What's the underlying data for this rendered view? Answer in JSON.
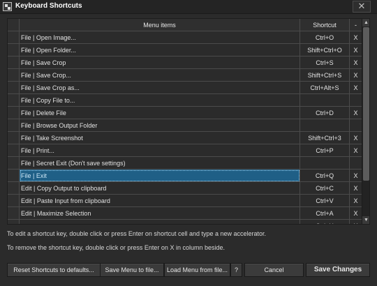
{
  "window": {
    "title": "Keyboard Shortcuts",
    "close_glyph": "✕"
  },
  "table": {
    "headers": {
      "item": "Menu items",
      "shortcut": "Shortcut",
      "remove": "-"
    },
    "selected_index": 13,
    "rows": [
      {
        "item": "File | Open Image...",
        "shortcut": "Ctrl+O",
        "remove": "X"
      },
      {
        "item": "File | Open Folder...",
        "shortcut": "Shift+Ctrl+O",
        "remove": "X"
      },
      {
        "item": "File | Save Crop",
        "shortcut": "Ctrl+S",
        "remove": "X"
      },
      {
        "item": "File | Save Crop...",
        "shortcut": "Shift+Ctrl+S",
        "remove": "X"
      },
      {
        "item": "File | Save Crop as...",
        "shortcut": "Ctrl+Alt+S",
        "remove": "X"
      },
      {
        "item": "File | Copy File to...",
        "shortcut": "",
        "remove": ""
      },
      {
        "item": "File | Delete File",
        "shortcut": "Ctrl+D",
        "remove": "X"
      },
      {
        "item": "File | Browse Output Folder",
        "shortcut": "",
        "remove": ""
      },
      {
        "item": "File | Take Screenshot",
        "shortcut": "Shift+Ctrl+3",
        "remove": "X"
      },
      {
        "item": "File | Print...",
        "shortcut": "Ctrl+P",
        "remove": "X"
      },
      {
        "item": "File | Secret Exit (Don't save settings)",
        "shortcut": "",
        "remove": ""
      },
      {
        "item": "File | Exit",
        "shortcut": "Ctrl+Q",
        "remove": "X"
      },
      {
        "item": "Edit | Copy Output to clipboard",
        "shortcut": "Ctrl+C",
        "remove": "X"
      },
      {
        "item": "Edit | Paste Input from clipboard",
        "shortcut": "Ctrl+V",
        "remove": "X"
      },
      {
        "item": "Edit | Maximize Selection",
        "shortcut": "Ctrl+A",
        "remove": "X"
      },
      {
        "item": "",
        "shortcut": "Ctrl+H",
        "remove": "X"
      }
    ]
  },
  "hints": {
    "line1": "To edit a shortcut key, double click or press Enter on shortcut cell and type a new accelerator.",
    "line2": "To remove the shortcut key, double click or press Enter on X in column beside."
  },
  "buttons": {
    "reset": "Reset Shortcuts to defaults...",
    "save_menu": "Save Menu to file...",
    "load_menu": "Load Menu from file...",
    "help": "?",
    "cancel": "Cancel",
    "save_changes": "Save Changes"
  },
  "colors": {
    "selection": "#1f5f86",
    "background": "#2b2b2b"
  }
}
